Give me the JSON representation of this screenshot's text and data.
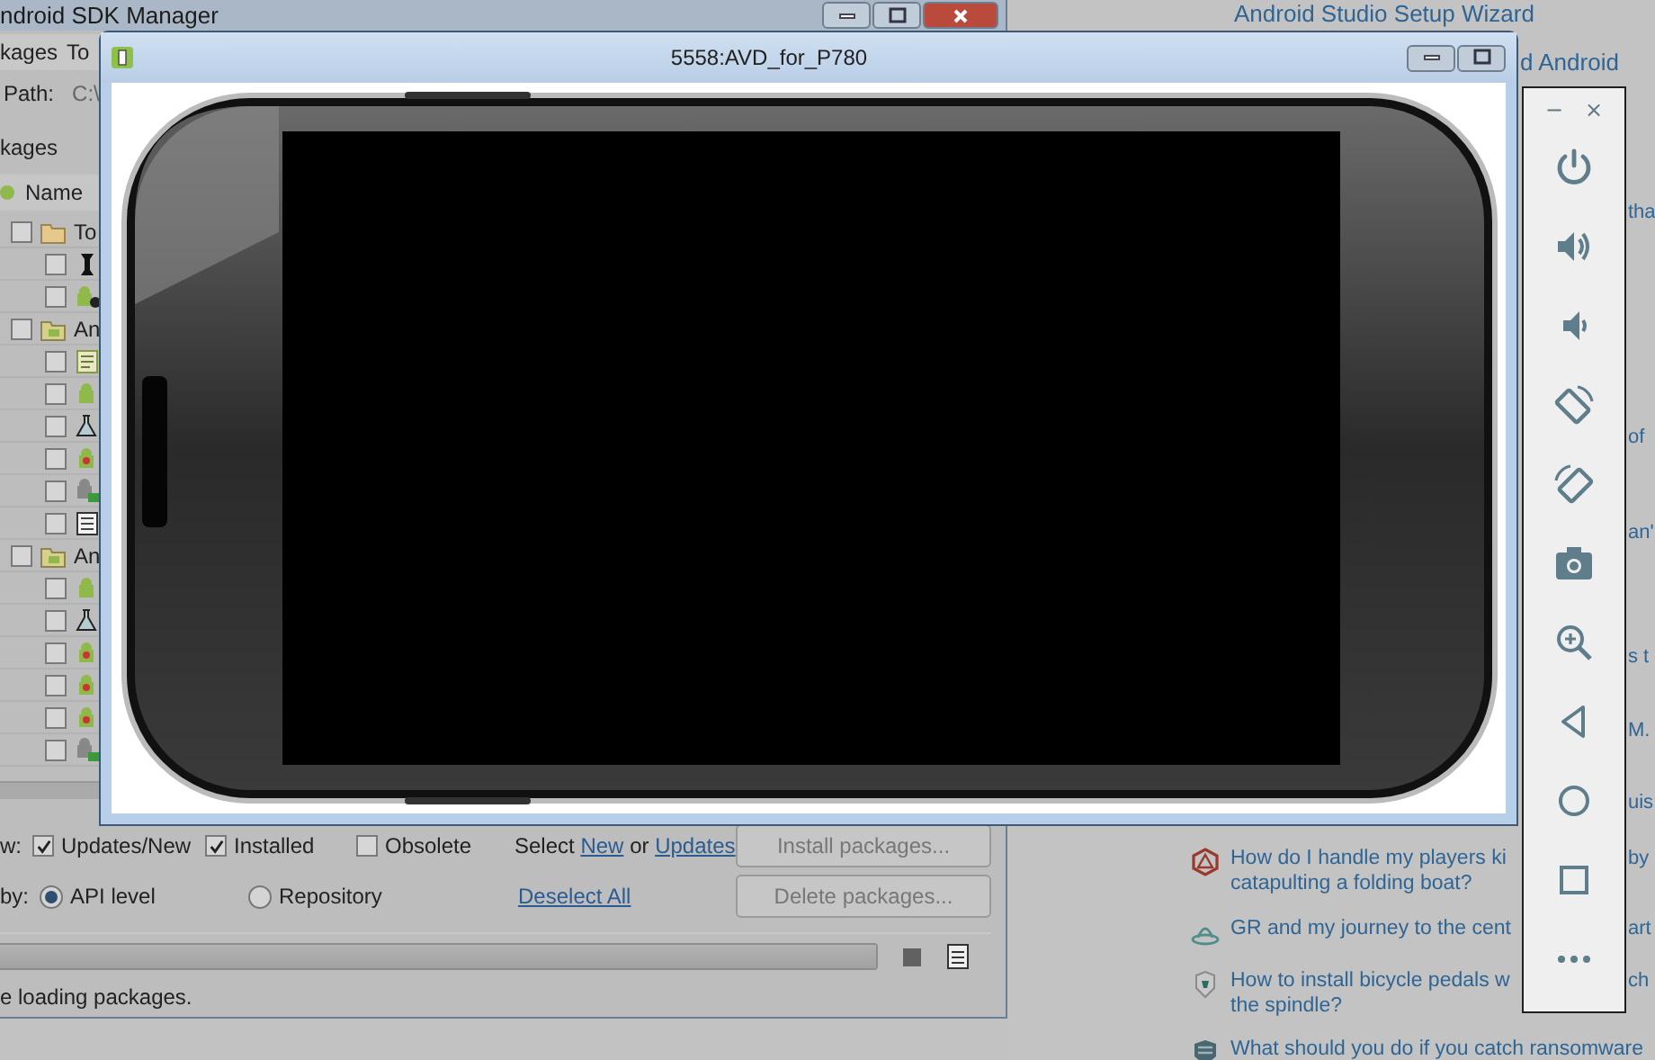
{
  "web_page": {
    "top_link": "Android Studio Setup Wizard",
    "heading_fragment": "d Android",
    "edge_fragments": [
      "tha",
      "of",
      "an'",
      "s t",
      "M.",
      "uis"
    ],
    "questions": [
      {
        "kind": "rpg",
        "lines": [
          "How do I handle my players ki",
          "catapulting a folding boat?"
        ],
        "tail": "by"
      },
      {
        "kind": "scifi",
        "lines": [
          "GR and my journey to the cent"
        ],
        "tail": "art"
      },
      {
        "kind": "bicycles",
        "lines": [
          "How to install bicycle pedals w",
          "the spindle?"
        ],
        "tail": "ch"
      },
      {
        "kind": "security",
        "lines": [
          "What should you do if you catch ransomware"
        ]
      }
    ]
  },
  "sdk_manager": {
    "title": "ndroid SDK Manager",
    "menu": [
      "kages",
      "To"
    ],
    "path_label": "Path:",
    "path_value": "C:\\",
    "group_label": "kages",
    "column_header": "Name",
    "tree": [
      {
        "label": "To",
        "checked": false,
        "kind": "folder",
        "children": [
          {
            "kind": "wrench",
            "checked": false
          },
          {
            "kind": "droid-gear",
            "checked": false
          }
        ]
      },
      {
        "label": "An",
        "checked": false,
        "kind": "droid-folder",
        "children": [
          {
            "kind": "doc",
            "checked": false
          },
          {
            "kind": "droid",
            "checked": false
          },
          {
            "kind": "flask",
            "checked": false
          },
          {
            "kind": "droid-heart",
            "checked": false
          },
          {
            "kind": "droid-puzzle",
            "checked": false
          },
          {
            "kind": "page",
            "checked": false
          }
        ]
      },
      {
        "label": "An",
        "checked": false,
        "kind": "droid-folder",
        "children": [
          {
            "kind": "droid",
            "checked": false
          },
          {
            "kind": "flask",
            "checked": false
          },
          {
            "kind": "droid-heart",
            "checked": false
          },
          {
            "kind": "droid-heart",
            "checked": false
          },
          {
            "kind": "droid-heart",
            "checked": false
          },
          {
            "kind": "droid-puzzle",
            "checked": false
          }
        ]
      }
    ],
    "show_label": "w:",
    "filters": [
      {
        "label": "Updates/New",
        "checked": true
      },
      {
        "label": "Installed",
        "checked": true
      },
      {
        "label": "Obsolete",
        "checked": false
      }
    ],
    "select_parts": [
      {
        "kind": "text",
        "text": "Select"
      },
      {
        "kind": "link",
        "text": "New"
      },
      {
        "kind": "text",
        "text": "or"
      },
      {
        "kind": "link",
        "text": "Updates"
      }
    ],
    "sort_label": "by:",
    "sort_options": [
      {
        "label": "API level",
        "selected": true
      },
      {
        "label": "Repository",
        "selected": false
      }
    ],
    "deselect_link": "Deselect All",
    "buttons": [
      {
        "label": "Install packages...",
        "disabled": true
      },
      {
        "label": "Delete packages...",
        "disabled": true
      }
    ],
    "progress": {
      "level": 1
    },
    "status": "e loading packages."
  },
  "emulator": {
    "title": "5558:AVD_for_P780"
  },
  "emulator_toolbar": {
    "window_controls": [
      "−",
      "×"
    ],
    "buttons": [
      {
        "kind": "power"
      },
      {
        "kind": "volume-up"
      },
      {
        "kind": "volume-down"
      },
      {
        "kind": "rotate-left"
      },
      {
        "kind": "rotate-right"
      },
      {
        "kind": "camera"
      },
      {
        "kind": "zoom"
      },
      {
        "kind": "back"
      },
      {
        "kind": "home"
      },
      {
        "kind": "overview"
      },
      {
        "kind": "more"
      }
    ]
  }
}
